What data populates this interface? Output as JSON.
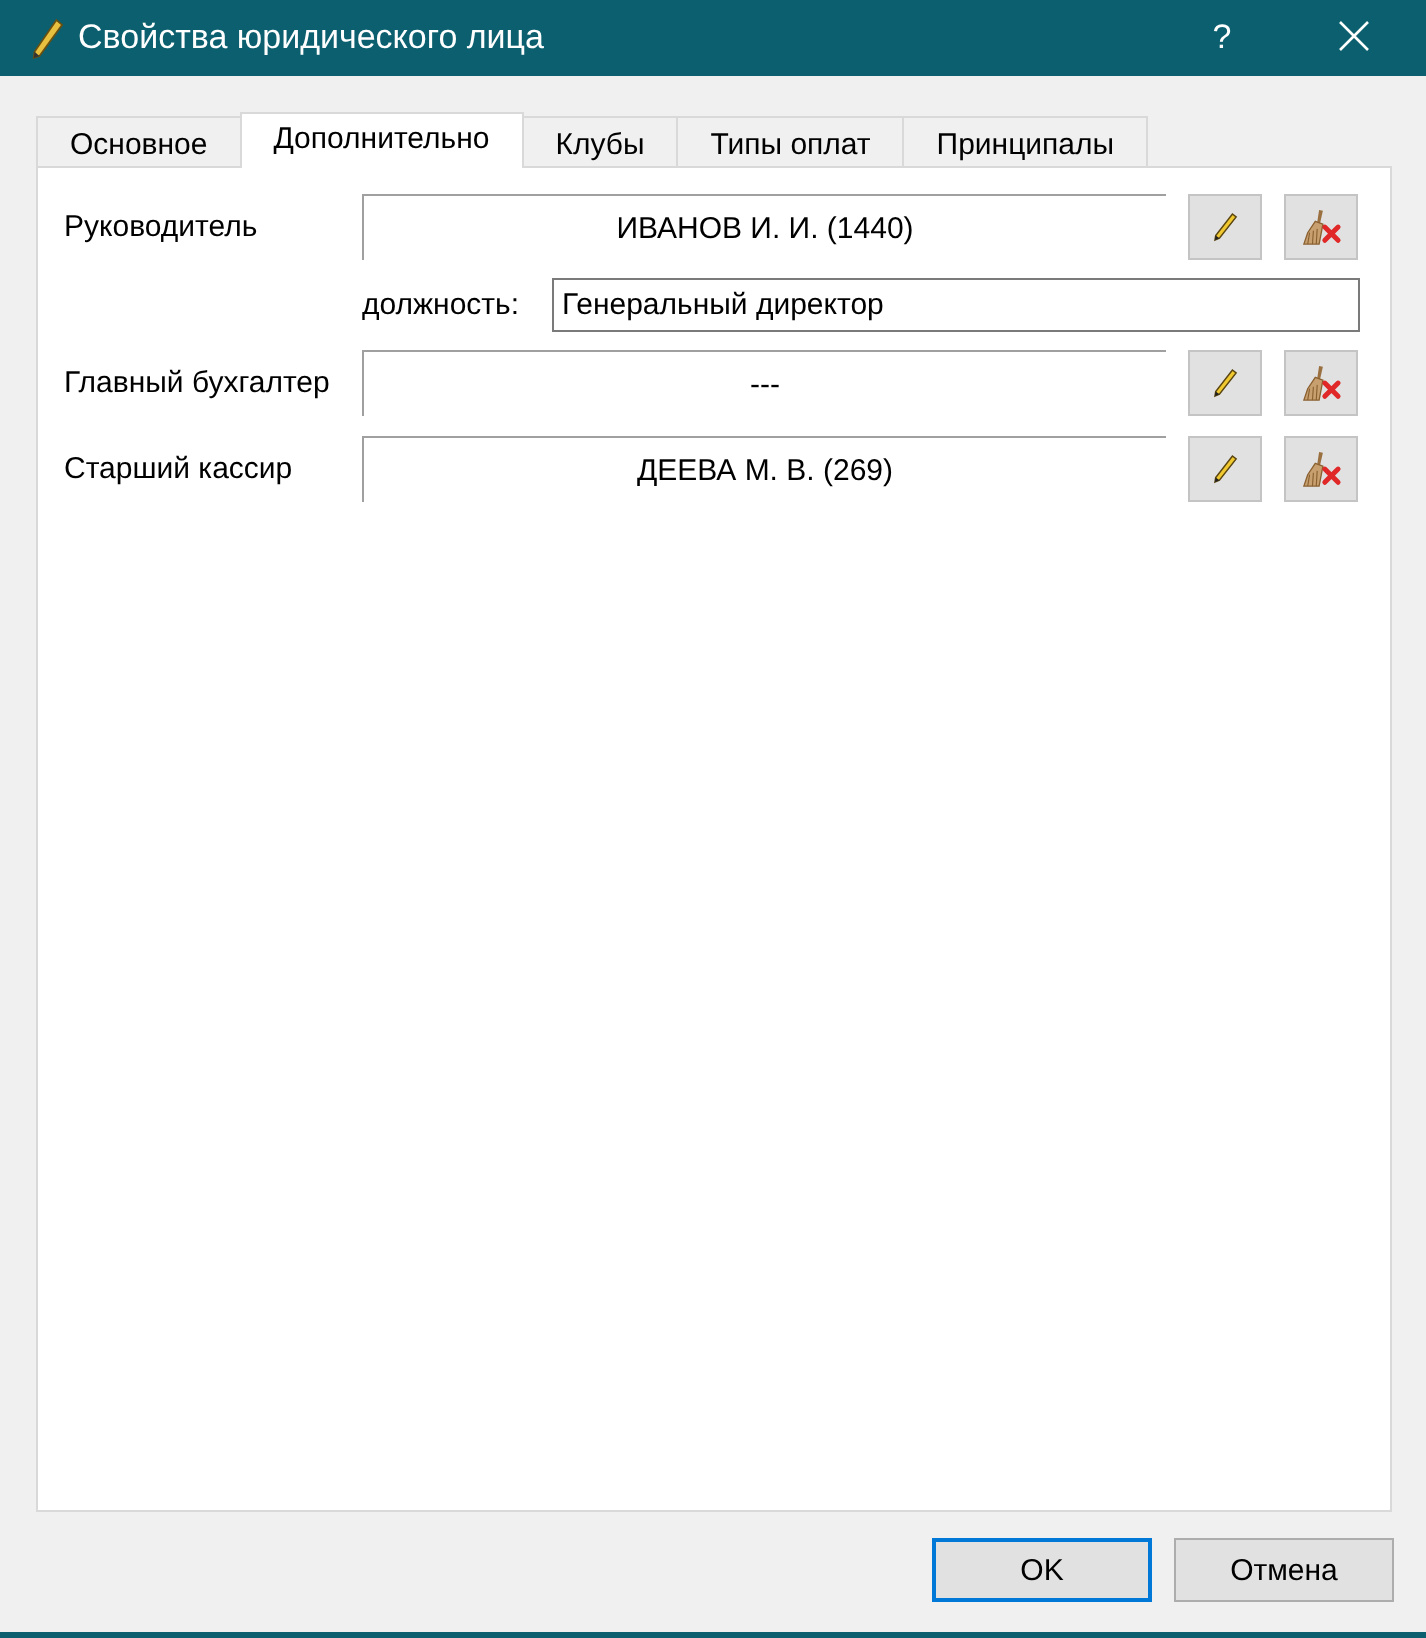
{
  "window": {
    "title": "Свойства юридического лица",
    "help": "?"
  },
  "tabs": [
    {
      "label": "Основное",
      "selected": false
    },
    {
      "label": "Дополнительно",
      "selected": true
    },
    {
      "label": "Клубы",
      "selected": false
    },
    {
      "label": "Типы оплат",
      "selected": false
    },
    {
      "label": "Принципалы",
      "selected": false
    }
  ],
  "fields": [
    {
      "label": "Руководитель",
      "value": "ИВАНОВ И. И. (1440)",
      "position": {
        "label": "должность:",
        "value": "Генеральный директор"
      }
    },
    {
      "label": "Главный бухгалтер",
      "value": "---"
    },
    {
      "label": "Старший кассир",
      "value": "ДЕЕВА М. В. (269)"
    }
  ],
  "buttons": [
    {
      "label": "OK",
      "default": true
    },
    {
      "label": "Отмена",
      "default": false
    }
  ]
}
